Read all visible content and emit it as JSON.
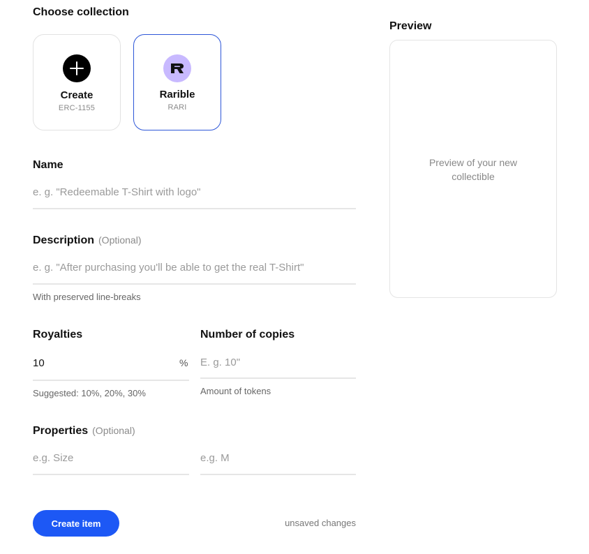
{
  "collection": {
    "heading": "Choose collection",
    "options": [
      {
        "title": "Create",
        "subtitle": "ERC-1155",
        "icon": "plus-icon",
        "selected": false
      },
      {
        "title": "Rarible",
        "subtitle": "RARI",
        "icon": "rarible-logo-icon",
        "selected": true
      }
    ]
  },
  "name_field": {
    "label": "Name",
    "placeholder": "e. g. \"Redeemable T-Shirt with logo\""
  },
  "description_field": {
    "label": "Description",
    "optional": "(Optional)",
    "placeholder": "e. g. \"After purchasing you'll be able to get the real T-Shirt\"",
    "hint": "With preserved line-breaks"
  },
  "royalties_field": {
    "label": "Royalties",
    "value": "10",
    "suffix": "%",
    "hint": "Suggested: 10%, 20%, 30%"
  },
  "copies_field": {
    "label": "Number of copies",
    "placeholder": "E. g. 10\"",
    "hint": "Amount of tokens"
  },
  "properties_field": {
    "label": "Properties",
    "optional": "(Optional)",
    "key_placeholder": "e.g. Size",
    "value_placeholder": "e.g. M"
  },
  "actions": {
    "create_label": "Create item",
    "status": "unsaved changes"
  },
  "preview": {
    "heading": "Preview",
    "empty_text": "Preview of your new collectible"
  },
  "colors": {
    "accent": "#1d58f5",
    "selected_border": "#2d56d8",
    "rarible_badge": "#c8b9ff"
  }
}
